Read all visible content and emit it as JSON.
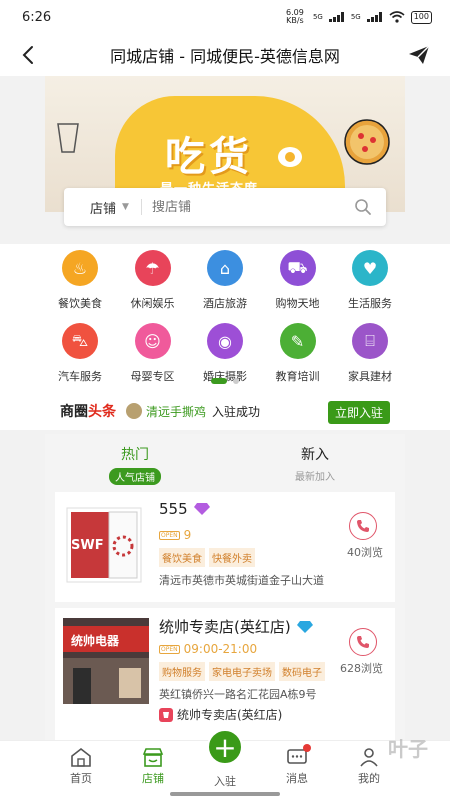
{
  "status_bar": {
    "time": "6:26",
    "net_speed": "6.09 KB/s",
    "signal1": "5G",
    "signal2": "5G",
    "battery": "100"
  },
  "nav": {
    "title": "同城店铺 - 同城便民-英德信息网"
  },
  "banner": {
    "headline": "吃货",
    "subline": "是一种生活态度"
  },
  "search": {
    "category": "店铺",
    "placeholder": "搜店铺"
  },
  "categories": [
    {
      "label": "餐饮美食",
      "color": "#f5a623",
      "icon": "chef-hat-icon",
      "glyph": "♨"
    },
    {
      "label": "休闲娱乐",
      "color": "#e8445a",
      "icon": "umbrella-icon",
      "glyph": "☂"
    },
    {
      "label": "酒店旅游",
      "color": "#3c8fe0",
      "icon": "hotel-icon",
      "glyph": "⌂"
    },
    {
      "label": "购物天地",
      "color": "#8e4fd6",
      "icon": "cart-icon",
      "glyph": "⛟"
    },
    {
      "label": "生活服务",
      "color": "#2bb5c9",
      "icon": "heart-hand-icon",
      "glyph": "♥"
    },
    {
      "label": "汽车服务",
      "color": "#f0523f",
      "icon": "car-icon",
      "glyph": "⛍"
    },
    {
      "label": "母婴专区",
      "color": "#f05a9b",
      "icon": "baby-icon",
      "glyph": "☺"
    },
    {
      "label": "婚庆摄影",
      "color": "#9d4fd6",
      "icon": "camera-icon",
      "glyph": "◉"
    },
    {
      "label": "教育培训",
      "color": "#4caf35",
      "icon": "graduation-cap-icon",
      "glyph": "✎"
    },
    {
      "label": "家具建材",
      "color": "#9b55c9",
      "icon": "sofa-icon",
      "glyph": "⌸"
    }
  ],
  "headline": {
    "brand_a": "商圈",
    "brand_b": "头条",
    "store": "清远手撕鸡",
    "action": "入驻成功",
    "button": "立即入驻"
  },
  "tabs": [
    {
      "title": "热门",
      "sub": "人气店铺"
    },
    {
      "title": "新入",
      "sub": "最新加入"
    }
  ],
  "shops": [
    {
      "name": "555",
      "open_badge": "OPEN",
      "hours": "9",
      "tags": [
        "餐饮美食",
        "快餐外卖"
      ],
      "address": "清远市英德市英城街道金子山大道",
      "views": "40浏览",
      "thumb_text": "SWF",
      "gem_color": "#b35ce0"
    },
    {
      "name": "统帅专卖店(英红店)",
      "open_badge": "OPEN",
      "hours": "09:00-21:00",
      "tags": [
        "购物服务",
        "家电电子卖场",
        "数码电子"
      ],
      "address": "英红镇侨兴一路名汇花园A栋9号",
      "sub_label": "统帅专卖店(英红店)",
      "views": "628浏览",
      "thumb_text": "统帅电器",
      "gem_color": "#2aa7e0"
    }
  ],
  "bottom_nav": [
    {
      "label": "首页"
    },
    {
      "label": "店铺"
    },
    {
      "label": "入驻"
    },
    {
      "label": "消息"
    },
    {
      "label": "我的"
    }
  ],
  "watermark": "叶子",
  "colors": {
    "primary_green": "#3c9a1f",
    "accent_red": "#e02b1d",
    "tag_orange": "#d1802c"
  }
}
